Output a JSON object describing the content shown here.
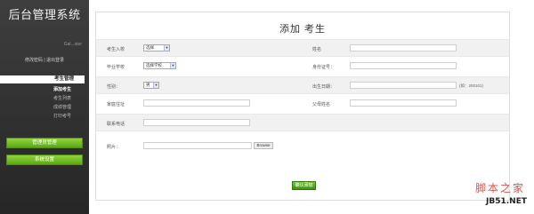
{
  "sidebar": {
    "title": "后台管理系统",
    "user": "Gal...ster",
    "user_links": "修改密码 | 退出登录",
    "current_menu": "考生管理",
    "submenu": [
      "添加考生",
      "考生列表",
      "成绩管理",
      "打印考号"
    ],
    "buttons": [
      "管理员管理",
      "系统设置"
    ]
  },
  "main": {
    "title": "添加 考生",
    "fields": {
      "name_label": "考生入校",
      "name_value": "选择",
      "surname_label": "姓名",
      "school_label": "毕业学校",
      "school_value": "选择学校",
      "idcard_label": "身份证号：",
      "gender_label": "性别：",
      "gender_value": "男",
      "birth_label": "出生日期：",
      "birth_hint": "(如：200101)",
      "address_label": "家庭住址",
      "graduation_label": "父母姓名",
      "phone_label": "联系电话",
      "photo_label": "照片：",
      "browse_label": "Browse"
    },
    "submit_label": "确认添加"
  },
  "watermark": {
    "line1": "脚本之家",
    "line2": "JB51.NET"
  }
}
